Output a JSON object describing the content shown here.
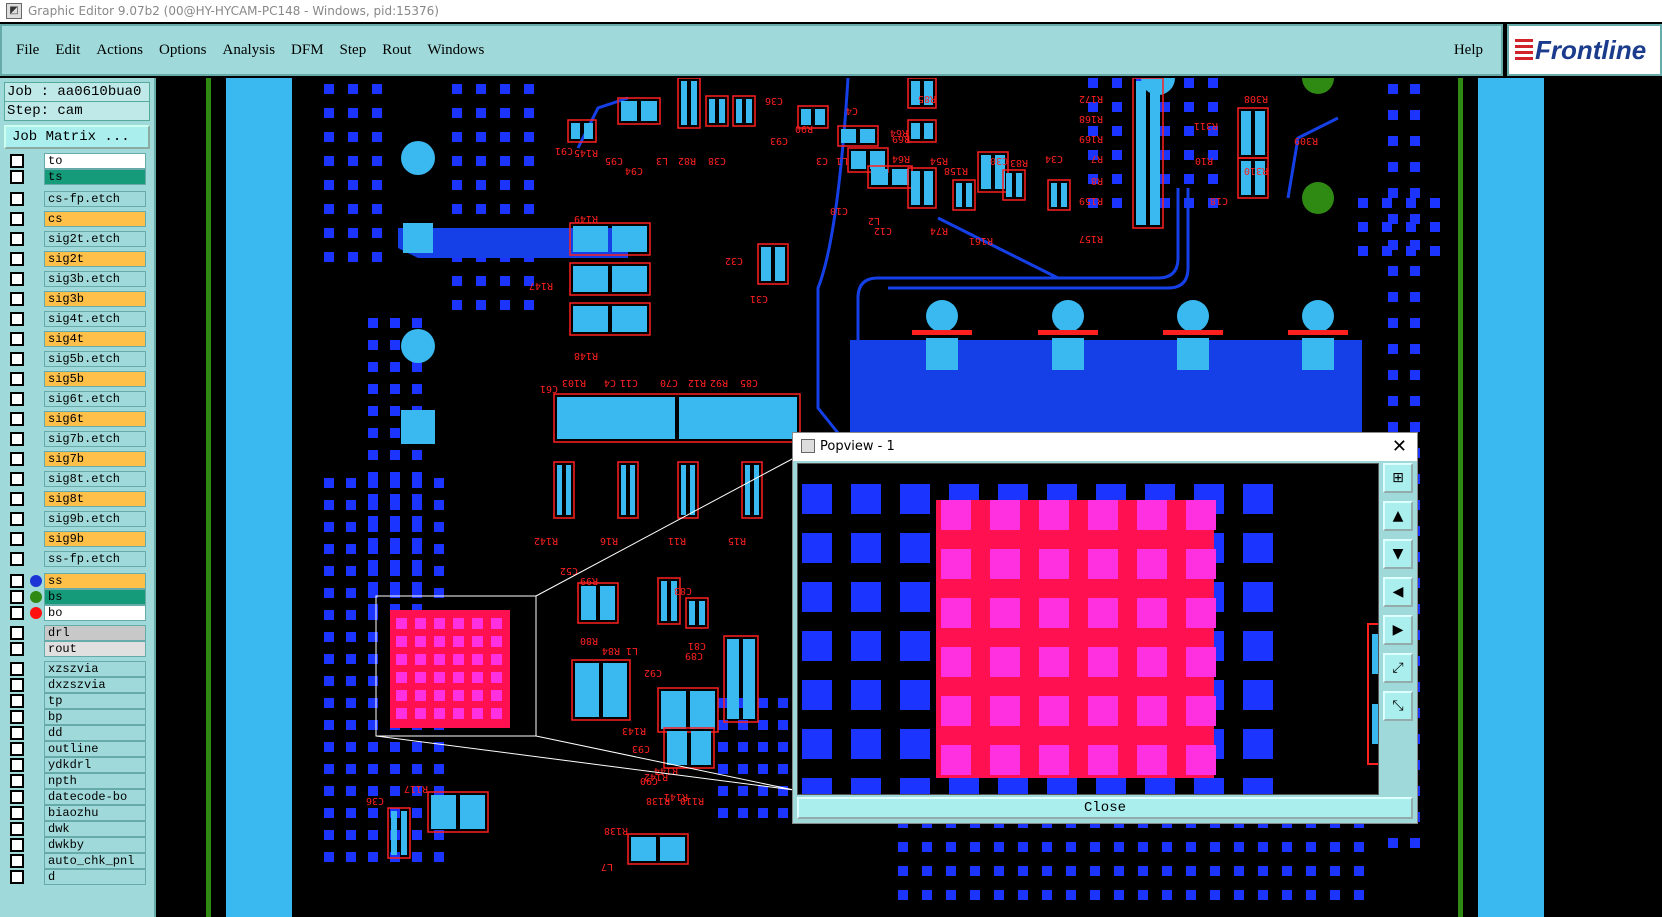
{
  "window": {
    "title": "Graphic Editor 9.07b2 (00@HY-HYCAM-PC148 - Windows, pid:15376)"
  },
  "menu": {
    "items": [
      "File",
      "Edit",
      "Actions",
      "Options",
      "Analysis",
      "DFM",
      "Step",
      "Rout",
      "Windows"
    ],
    "help": "Help"
  },
  "logo": {
    "text": "Frontline"
  },
  "job": {
    "job_line": "Job : aa0610bua0",
    "step_line": "Step: cam",
    "matrix_button": "Job Matrix ..."
  },
  "layers": [
    {
      "name": "to",
      "color": "#ffffff",
      "dot": ""
    },
    {
      "name": "ts",
      "color": "#159a7a",
      "dot": ""
    },
    {
      "name": "cs-fp.etch",
      "color": "#9fd9d9",
      "dot": ""
    },
    {
      "name": "cs",
      "color": "#ffc04a",
      "dot": ""
    },
    {
      "name": "sig2t.etch",
      "color": "#9fd9d9",
      "dot": ""
    },
    {
      "name": "sig2t",
      "color": "#ffc04a",
      "dot": ""
    },
    {
      "name": "sig3b.etch",
      "color": "#9fd9d9",
      "dot": ""
    },
    {
      "name": "sig3b",
      "color": "#ffc04a",
      "dot": ""
    },
    {
      "name": "sig4t.etch",
      "color": "#9fd9d9",
      "dot": ""
    },
    {
      "name": "sig4t",
      "color": "#ffc04a",
      "dot": ""
    },
    {
      "name": "sig5b.etch",
      "color": "#9fd9d9",
      "dot": ""
    },
    {
      "name": "sig5b",
      "color": "#ffc04a",
      "dot": ""
    },
    {
      "name": "sig6t.etch",
      "color": "#9fd9d9",
      "dot": ""
    },
    {
      "name": "sig6t",
      "color": "#ffc04a",
      "dot": ""
    },
    {
      "name": "sig7b.etch",
      "color": "#9fd9d9",
      "dot": ""
    },
    {
      "name": "sig7b",
      "color": "#ffc04a",
      "dot": ""
    },
    {
      "name": "sig8t.etch",
      "color": "#9fd9d9",
      "dot": ""
    },
    {
      "name": "sig8t",
      "color": "#ffc04a",
      "dot": ""
    },
    {
      "name": "sig9b.etch",
      "color": "#9fd9d9",
      "dot": ""
    },
    {
      "name": "sig9b",
      "color": "#ffc04a",
      "dot": ""
    },
    {
      "name": "ss-fp.etch",
      "color": "#9fd9d9",
      "dot": ""
    }
  ],
  "layers_active": [
    {
      "name": "ss",
      "color": "#ffc04a",
      "dot": "#1c34d6"
    },
    {
      "name": "bs",
      "color": "#159a7a",
      "dot": "#2e8a12"
    },
    {
      "name": "bo",
      "color": "#ffffff",
      "dot": "#ff1010"
    }
  ],
  "layers_drill": [
    {
      "name": "drl",
      "color": "#c8c8c8",
      "dot": ""
    },
    {
      "name": "rout",
      "color": "#e0e0e0",
      "dot": ""
    }
  ],
  "layers_misc": [
    {
      "name": "xzszvia",
      "color": "#9fd9d9",
      "dot": ""
    },
    {
      "name": "dxzszvia",
      "color": "#9fd9d9",
      "dot": ""
    },
    {
      "name": "tp",
      "color": "#9fd9d9",
      "dot": ""
    },
    {
      "name": "bp",
      "color": "#9fd9d9",
      "dot": ""
    },
    {
      "name": "dd",
      "color": "#9fd9d9",
      "dot": ""
    },
    {
      "name": "outline",
      "color": "#9fd9d9",
      "dot": ""
    },
    {
      "name": "ydkdrl",
      "color": "#9fd9d9",
      "dot": ""
    },
    {
      "name": "npth",
      "color": "#9fd9d9",
      "dot": ""
    },
    {
      "name": "datecode-bo",
      "color": "#9fd9d9",
      "dot": ""
    },
    {
      "name": "biaozhu",
      "color": "#9fd9d9",
      "dot": ""
    },
    {
      "name": "dwk",
      "color": "#9fd9d9",
      "dot": ""
    },
    {
      "name": "dwkby",
      "color": "#9fd9d9",
      "dot": ""
    },
    {
      "name": "auto_chk_pnl",
      "color": "#9fd9d9",
      "dot": ""
    },
    {
      "name": "d",
      "color": "#9fd9d9",
      "dot": ""
    }
  ],
  "board_labels": [
    "C91",
    "R145",
    "C95",
    "C94",
    "L3",
    "R82",
    "C38",
    "C36",
    "C93",
    "R90",
    "C3",
    "L1",
    "C10",
    "L2",
    "C12",
    "C4",
    "R64",
    "R85",
    "R69",
    "R64",
    "R54",
    "R158",
    "C30",
    "R83",
    "C34",
    "R74",
    "R161",
    "R172",
    "R168",
    "R169",
    "R7",
    "R8",
    "R159",
    "R157",
    "R308",
    "R311",
    "R309",
    "R310",
    "R10",
    "C18",
    "R149",
    "R147",
    "R148",
    "C32",
    "C31",
    "C61",
    "R103",
    "C4",
    "C11",
    "C70",
    "R12",
    "R92",
    "C85",
    "R142",
    "R16",
    "R11",
    "R15",
    "C52",
    "R99",
    "R80",
    "R84",
    "L1",
    "C92",
    "C83",
    "C81",
    "C89",
    "R143",
    "C93",
    "R144",
    "R142",
    "C90",
    "R141",
    "R138",
    "R110",
    "R117",
    "C36",
    "R138",
    "L7"
  ],
  "popview": {
    "title": "Popview - 1",
    "close_label": "Close",
    "tools": [
      "fit-icon",
      "up-icon",
      "down-icon",
      "left-icon",
      "right-icon",
      "zoom-in-icon",
      "zoom-out-icon"
    ]
  },
  "colors": {
    "pad": "#1c34ff",
    "copper": "#1540e8",
    "silk": "#ff2020",
    "smd": "#3ab8f0",
    "highlight": "#ff1050",
    "highlight_pad": "#ff30e0",
    "green": "#2e8a12",
    "panel": "#9fd9d9"
  }
}
